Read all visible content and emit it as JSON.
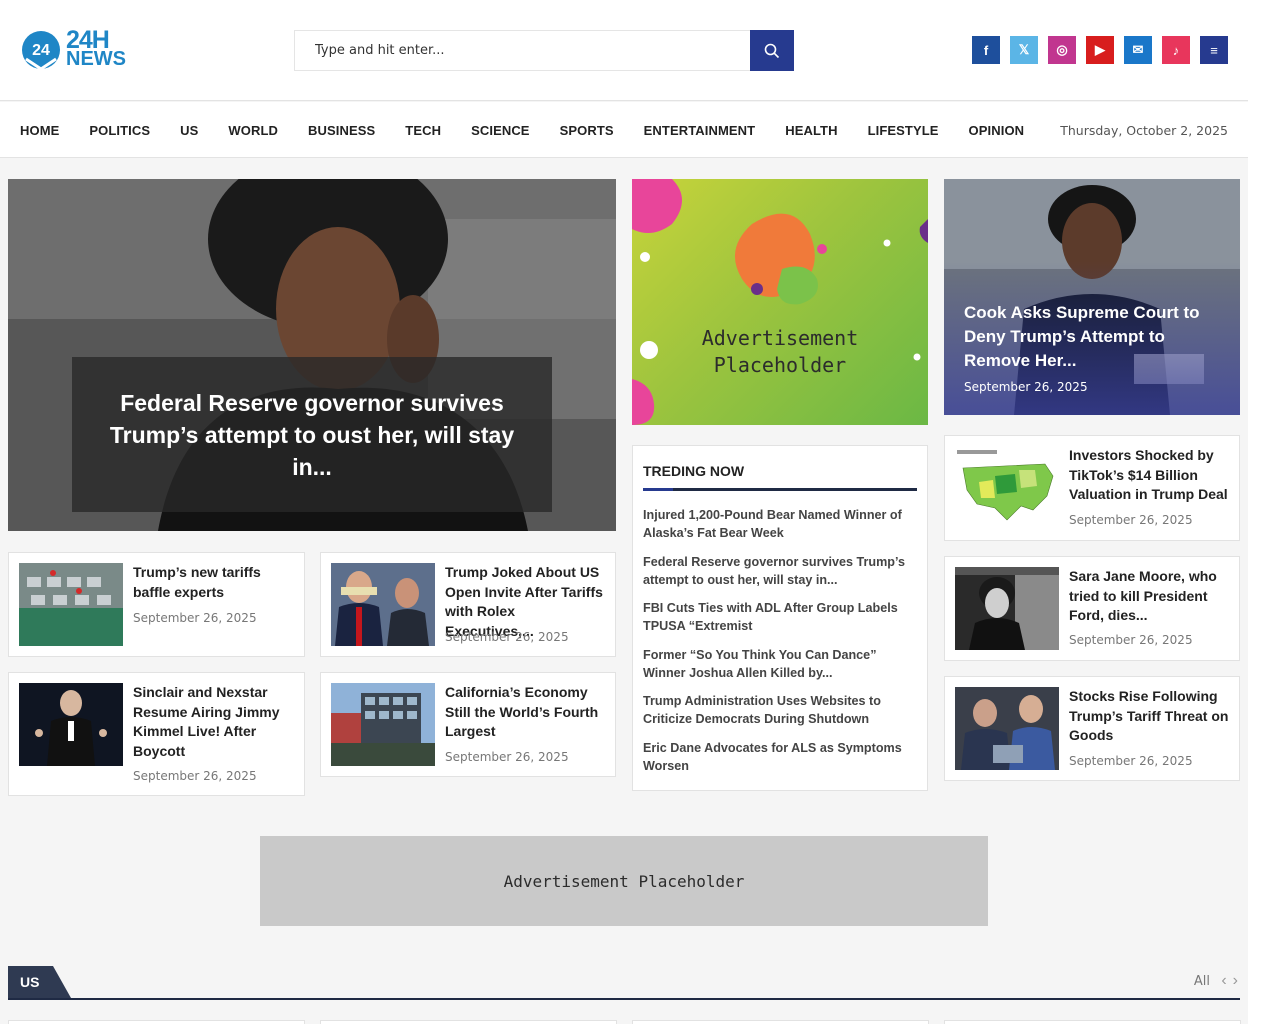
{
  "header": {
    "logo": {
      "line1": "24H",
      "line2": "NEWS",
      "mark": "24"
    },
    "search": {
      "placeholder": "Type and hit enter..."
    },
    "socials": [
      {
        "icon": "facebook-icon",
        "glyph": "f",
        "color": "#1e4f9c"
      },
      {
        "icon": "x-icon",
        "glyph": "𝕏",
        "color": "#5bb5e6"
      },
      {
        "icon": "instagram-icon",
        "glyph": "◎",
        "color": "#c1368f"
      },
      {
        "icon": "youtube-icon",
        "glyph": "▶",
        "color": "#d81d1d"
      },
      {
        "icon": "email-icon",
        "glyph": "✉",
        "color": "#1a77c9"
      },
      {
        "icon": "tiktok-icon",
        "glyph": "♪",
        "color": "#e8365c"
      },
      {
        "icon": "menu-icon",
        "glyph": "≡",
        "color": "#263a8f"
      }
    ]
  },
  "nav": {
    "items": [
      "HOME",
      "POLITICS",
      "US",
      "WORLD",
      "BUSINESS",
      "TECH",
      "SCIENCE",
      "SPORTS",
      "ENTERTAINMENT",
      "HEALTH",
      "LIFESTYLE",
      "OPINION"
    ],
    "date": "Thursday, October 2, 2025"
  },
  "hero": {
    "title": "Federal Reserve governor survives Trump’s attempt to oust her, will stay in..."
  },
  "cards": [
    {
      "title": "Trump’s new tariffs baffle experts",
      "date": "September 26, 2025"
    },
    {
      "title": "Trump Joked About US Open Invite After Tariffs with Rolex Executives,...",
      "date": "September 26, 2025"
    },
    {
      "title": "Sinclair and Nexstar Resume Airing Jimmy Kimmel Live! After Boycott",
      "date": "September 26, 2025"
    },
    {
      "title": "California’s Economy Still the World’s Fourth Largest",
      "date": "September 26, 2025"
    }
  ],
  "ad_side": {
    "line1": "Advertisement",
    "line2": "Placeholder"
  },
  "trending": {
    "heading": "TREDING NOW",
    "items": [
      "Injured 1,200-Pound Bear Named Winner of Alaska’s Fat Bear Week",
      "Federal Reserve governor survives Trump’s attempt to oust her, will stay in...",
      "FBI Cuts Ties with ADL After Group Labels TPUSA “Extremist",
      "Former “So You Think You Can Dance” Winner Joshua Allen Killed by...",
      "Trump Administration Uses Websites to Criticize Democrats During Shutdown",
      "Eric Dane Advocates for ALS as Symptoms Worsen"
    ]
  },
  "right_feature": {
    "title": "Cook Asks Supreme Court to Deny Trump’s Attempt to Remove Her...",
    "date": "September 26, 2025"
  },
  "right_cards": [
    {
      "title": "Investors Shocked by TikTok’s $14 Billion Valuation in Trump Deal",
      "date": "September 26, 2025"
    },
    {
      "title": "Sara Jane Moore, who tried to kill President Ford, dies...",
      "date": "September 26, 2025"
    },
    {
      "title": "Stocks Rise Following Trump’s Tariff Threat on Goods",
      "date": "September 26, 2025"
    }
  ],
  "ad_banner": {
    "text": "Advertisement Placeholder"
  },
  "section": {
    "tag": "US",
    "all": "All"
  }
}
